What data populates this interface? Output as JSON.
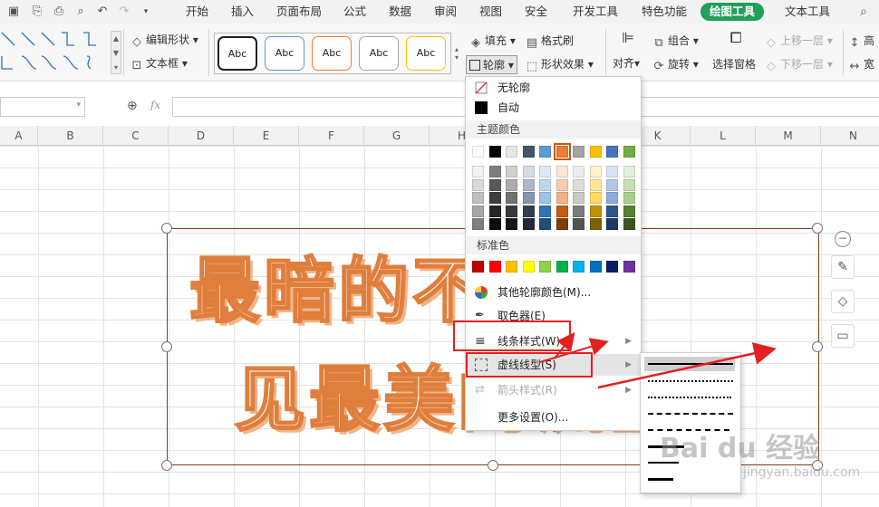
{
  "menubar": {
    "tabs": [
      "开始",
      "插入",
      "页面布局",
      "公式",
      "数据",
      "审阅",
      "视图",
      "安全",
      "开发工具",
      "特色功能",
      "绘图工具",
      "文本工具"
    ],
    "active_tab": "绘图工具"
  },
  "ribbon": {
    "edit_shape": "编辑形状",
    "text_box": "文本框",
    "style_samples": [
      "Abc",
      "Abc",
      "Abc",
      "Abc",
      "Abc"
    ],
    "fill": "填充",
    "format_painter": "格式刷",
    "outline": "轮廓",
    "shape_effects": "形状效果",
    "align": "对齐",
    "group": "组合",
    "rotate": "旋转",
    "selection_pane": "选择窗格",
    "bring_forward": "上移一层",
    "send_backward": "下移一层",
    "height_label": "高",
    "width_label": "宽"
  },
  "formula": {
    "fx": "fx"
  },
  "columns": [
    "A",
    "B",
    "C",
    "D",
    "E",
    "F",
    "G",
    "H",
    "",
    "",
    "K",
    "L",
    "M",
    "N"
  ],
  "shape_text": {
    "line1": "最暗的不会看",
    "line2": "见最美的流星"
  },
  "outline_menu": {
    "no_outline": "无轮廓",
    "auto": "自动",
    "theme_colors_header": "主题颜色",
    "standard_colors_header": "标准色",
    "more_colors": "其他轮廓颜色(M)...",
    "eyedropper": "取色器(E)",
    "line_style": "线条样式(W)",
    "dash_type": "虚线线型(S)",
    "arrow_style": "箭头样式(R)",
    "more_settings": "更多设置(O)..."
  },
  "theme_row_top": [
    "#ffffff",
    "#000000",
    "#e7e6e6",
    "#44546a",
    "#5b9bd5",
    "#ed7d31",
    "#a5a5a5",
    "#ffc000",
    "#4472c4",
    "#70ad47"
  ],
  "theme_shades": [
    [
      "#f2f2f2",
      "#7f7f7f",
      "#d0cece",
      "#d6dce4",
      "#deebf6",
      "#fbe5d5",
      "#ededed",
      "#fff2cc",
      "#dae3f3",
      "#e2efd9"
    ],
    [
      "#d8d8d8",
      "#595959",
      "#aeabab",
      "#adb9ca",
      "#bdd7ee",
      "#f8cbad",
      "#dbdbdb",
      "#ffe699",
      "#b4c7e7",
      "#c5e0b3"
    ],
    [
      "#bfbfbf",
      "#3f3f3f",
      "#757070",
      "#8496b0",
      "#9dc3e6",
      "#f4b183",
      "#c9c9c9",
      "#ffd965",
      "#8faadc",
      "#a8d08d"
    ],
    [
      "#a5a5a5",
      "#262626",
      "#3a3838",
      "#323f4f",
      "#2e75b5",
      "#c55a11",
      "#7b7b7b",
      "#bf9000",
      "#2f5597",
      "#538135"
    ],
    [
      "#7f7f7f",
      "#0c0c0c",
      "#171616",
      "#222a35",
      "#1e4e79",
      "#833c0b",
      "#525252",
      "#7f6000",
      "#203864",
      "#375623"
    ]
  ],
  "standard_colors": [
    "#c00000",
    "#ff0000",
    "#ffc000",
    "#ffff00",
    "#92d050",
    "#00b050",
    "#00b0f0",
    "#0070c0",
    "#002060",
    "#7030a0"
  ],
  "watermark": {
    "text": "Bai du 经验",
    "sub": "jingyan.baidu.com"
  }
}
